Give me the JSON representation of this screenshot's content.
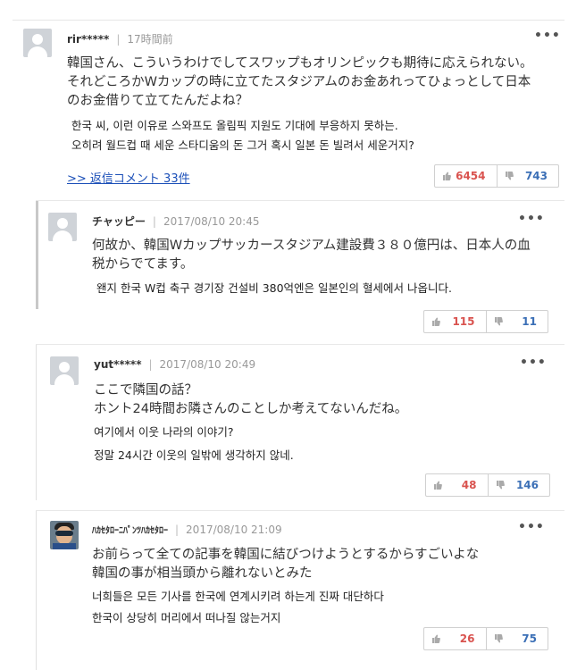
{
  "comments": [
    {
      "user": "rir*****",
      "time": "17時間前",
      "more": "•••",
      "jp_lines": [
        "韓国さん、こういうわけでしてスワップもオリンピックも期待に応えられない。",
        "それどころかWカップの時に立てたスタジアムのお金あれってひょっとして日本",
        "のお金借りて立てたんだよね？"
      ],
      "kr_lines": [
        "한국 씨, 이런 이유로 스와프도 올림픽 지원도 기대에 부응하지 못하는.",
        "오히려 월드컵 때 세운 스타디움의 돈 그거 혹시 일본 돈 빌려서 세운거지?"
      ],
      "reply_link": ">> 返信コメント 33件",
      "likes": "6454",
      "dislikes": "743"
    },
    {
      "user": "チャッピー",
      "time": "2017/08/10 20:45",
      "more": "•••",
      "jp_lines": [
        "何故か、韓国Wカップサッカースタジアム建設費３８０億円は、日本人の血",
        "税からでてます。"
      ],
      "kr_lines": [
        "왠지 한국 W컵 축구 경기장 건설비 380억엔은 일본인의 혈세에서 나옵니다."
      ],
      "likes": "115",
      "dislikes": "11"
    },
    {
      "user": "yut*****",
      "time": "2017/08/10 20:49",
      "more": "•••",
      "jp_lines": [
        "ここで隣国の話？",
        "ホント24時間お隣さんのことしか考えてないんだね。"
      ],
      "kr_lines": [
        "여기에서 이웃 나라의 이야기?",
        "정말 24시간 이웃의 일밖에 생각하지 않네."
      ],
      "likes": "48",
      "dislikes": "146"
    },
    {
      "user": "ﾊｶｾﾀﾛｰﾆﾊﾟﾝﾂﾊｶｾﾀﾛｰ",
      "time": "2017/08/10 21:09",
      "more": "•••",
      "jp_lines": [
        "お前らって全ての記事を韓国に結びつけようとするからすごいよな",
        "韓国の事が相当頭から離れないとみた"
      ],
      "kr_lines": [
        "너희들은 모든 기사를 한국에 연계시키려 하는게 진짜 대단하다",
        "한국이 상당히 머리에서 떠나질 않는거지"
      ],
      "likes": "26",
      "dislikes": "75"
    }
  ],
  "icons": {
    "avatar": "default-user-avatar",
    "avatar_photo": "user-photo-avatar",
    "like": "thumbs-up-icon",
    "dislike": "thumbs-down-icon",
    "more": "more-options-icon"
  },
  "colors": {
    "like": "#d9534f",
    "dislike": "#3b6fb6",
    "link": "#1b4fb8"
  }
}
